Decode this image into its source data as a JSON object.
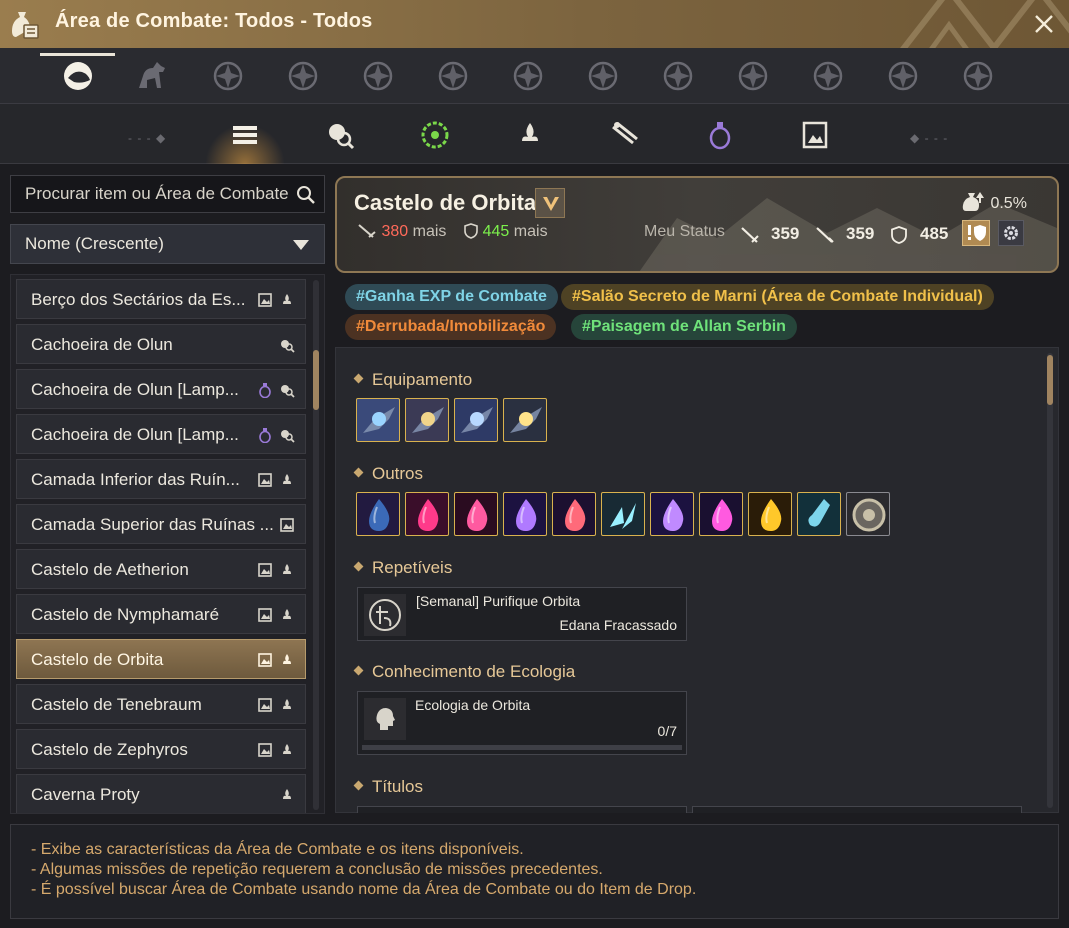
{
  "window": {
    "title": "Área de Combate: Todos - Todos"
  },
  "categories": [
    {
      "icon": "all-regions-icon"
    },
    {
      "icon": "horse-icon"
    },
    {
      "icon": "lion-icon"
    },
    {
      "icon": "eagle-crest-icon"
    },
    {
      "icon": "crescent-moon-icon"
    },
    {
      "icon": "ornament-icon"
    },
    {
      "icon": "flame-crest-icon"
    },
    {
      "icon": "celtic-knot-icon"
    },
    {
      "icon": "star-crest-icon"
    },
    {
      "icon": "sun-burst-icon"
    },
    {
      "icon": "compass-star-icon"
    },
    {
      "icon": "ring-rune-icon"
    },
    {
      "icon": "swirl-rune-icon"
    }
  ],
  "subtabs": [
    {
      "icon": "list-icon"
    },
    {
      "icon": "monster-search-icon"
    },
    {
      "icon": "gear-wheel-icon"
    },
    {
      "icon": "camp-fire-icon"
    },
    {
      "icon": "scroll-icon"
    },
    {
      "icon": "lamp-icon"
    },
    {
      "icon": "picture-frame-icon"
    }
  ],
  "search": {
    "placeholder": "Procurar item ou Área de Combate"
  },
  "sort": {
    "label": "Nome (Crescente)"
  },
  "zones": [
    {
      "name": "Berço dos Sectários da Es...",
      "icons": [
        "frame",
        "camp"
      ]
    },
    {
      "name": "Cachoeira de Olun",
      "icons": [
        "search"
      ]
    },
    {
      "name": "Cachoeira de Olun [Lamp...",
      "icons": [
        "lamp",
        "search"
      ]
    },
    {
      "name": "Cachoeira de Olun [Lamp...",
      "icons": [
        "lamp",
        "search"
      ]
    },
    {
      "name": "Camada Inferior das Ruín...",
      "icons": [
        "frame",
        "camp"
      ]
    },
    {
      "name": "Camada Superior das Ruínas ...",
      "icons": [
        "frame"
      ]
    },
    {
      "name": "Castelo de Aetherion",
      "icons": [
        "frame",
        "camp"
      ]
    },
    {
      "name": "Castelo de Nymphamaré",
      "icons": [
        "frame",
        "camp"
      ]
    },
    {
      "name": "Castelo de Orbita",
      "icons": [
        "frame",
        "camp"
      ],
      "selected": true
    },
    {
      "name": "Castelo de Tenebraum",
      "icons": [
        "frame",
        "camp"
      ]
    },
    {
      "name": "Castelo de Zephyros",
      "icons": [
        "frame",
        "camp"
      ]
    },
    {
      "name": "Caverna Proty",
      "icons": [
        "camp"
      ]
    }
  ],
  "area": {
    "name": "Castelo de Orbita",
    "atk_value": "380",
    "def_value": "445",
    "more": "mais",
    "drop_rate": "0.5%",
    "my_status_label": "Meu Status",
    "ap": "359",
    "aap": "359",
    "dp": "485"
  },
  "tags": [
    {
      "label": "#Ganha EXP de Combate",
      "color": "#7fd3e6",
      "bg": "#2f4a55"
    },
    {
      "label": "#Salão Secreto de Marni (Área de Combate Individual)",
      "color": "#f0c04a",
      "bg": "#4e4224"
    },
    {
      "label": "#Derrubada/Imobilização",
      "color": "#f08a3a",
      "bg": "#4c3222"
    },
    {
      "label": "#Paisagem de Allan Serbin",
      "color": "#6fe27a",
      "bg": "#26453a"
    }
  ],
  "sections": {
    "equipment": "Equipamento",
    "others": "Outros",
    "repeatable": "Repetíveis",
    "ecology": "Conhecimento de Ecologia",
    "titles": "Títulos"
  },
  "equipment_items": [
    "gauntlet-icon",
    "spider-ornament-icon",
    "armor-ornament-icon",
    "blade-icon"
  ],
  "other_items": [
    "dark-crystal-icon",
    "pink-gem-icon",
    "red-crystal-icon",
    "purple-crystal-icon",
    "ruby-crystal-icon",
    "ice-shards-icon",
    "violet-crystal-icon",
    "magenta-crystal-icon",
    "gold-gem-icon",
    "elixir-icon",
    "shield-coin-icon"
  ],
  "quest": {
    "title": "[Semanal] Purifique Orbita",
    "npc": "Edana Fracassado"
  },
  "ecology": {
    "title": "Ecologia de Orbita",
    "progress": "0/7",
    "fraction": 0
  },
  "help": [
    "- Exibe as características da Área de Combate e os itens disponíveis.",
    "- Algumas missões de repetição requerem a conclusão de missões precedentes.",
    "- É possível buscar Área de Combate usando nome da Área de Combate ou do Item de Drop."
  ]
}
